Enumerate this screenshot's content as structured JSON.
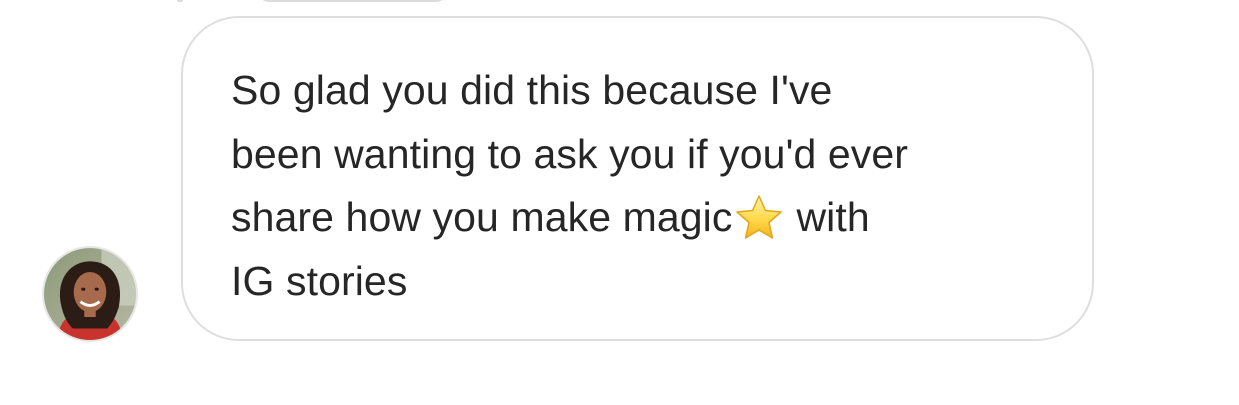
{
  "thread": {
    "message": {
      "line_1": "So glad you did this because I've",
      "line_2": "been wanting to ask you if you'd ever",
      "line_3_before_emoji": "share how you make magic",
      "line_3_after_emoji": "with",
      "line_4": "IG stories",
      "emoji_icon": "star-emoji",
      "bubble_border_color": "#dedede",
      "text_color": "#262626"
    },
    "sender": {
      "avatar_icon": "profile-photo"
    }
  }
}
